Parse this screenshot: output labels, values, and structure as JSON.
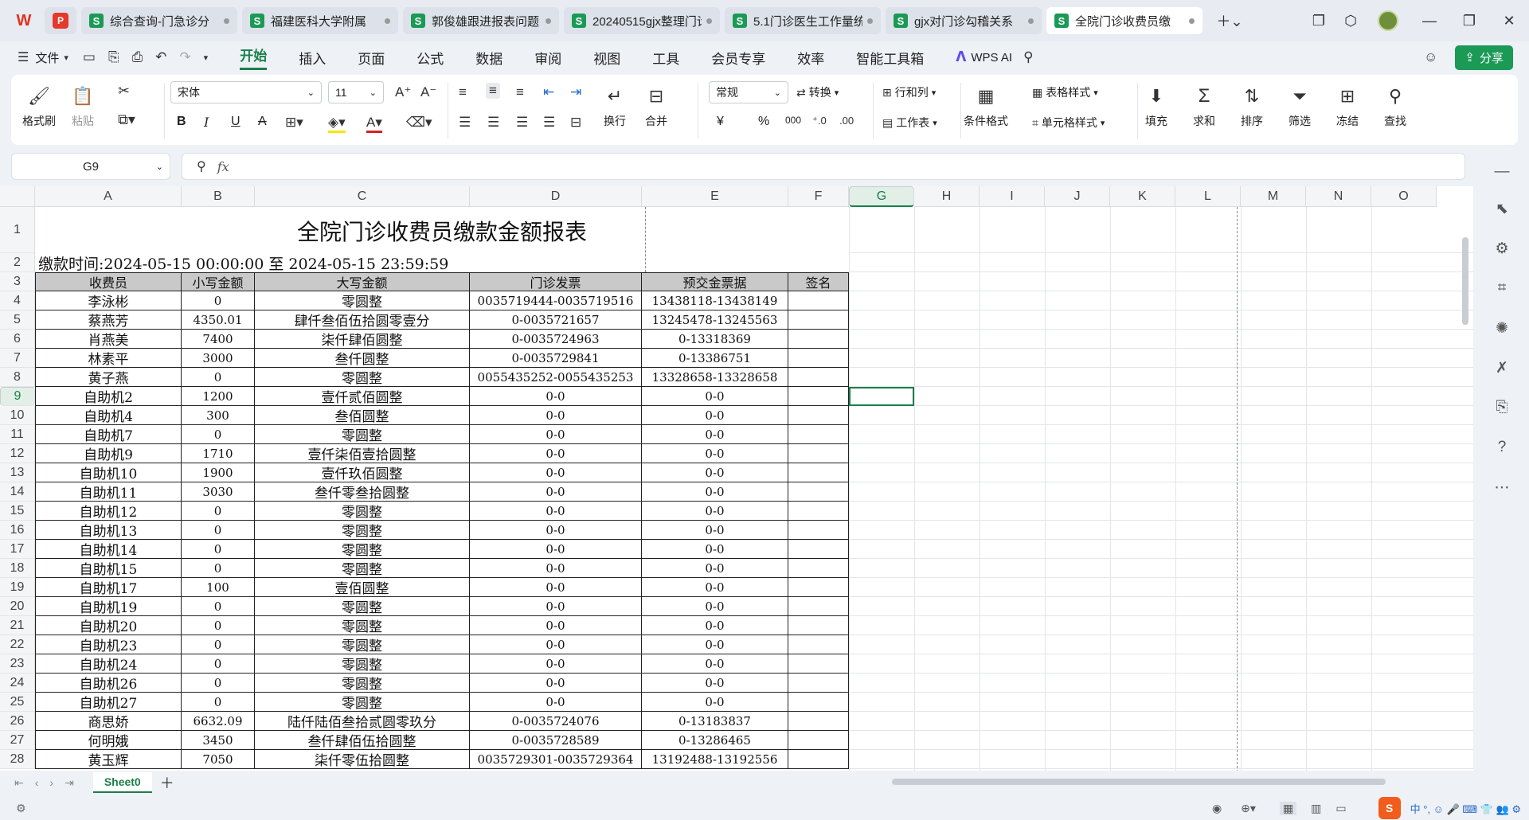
{
  "tabs": [
    {
      "label": "综合查询-门急诊分"
    },
    {
      "label": "福建医科大学附属"
    },
    {
      "label": "郭俊雄跟进报表问题"
    },
    {
      "label": "20240515gjx整理门诊"
    },
    {
      "label": "5.1门诊医生工作量统"
    },
    {
      "label": "gjx对门诊勾稽关系"
    },
    {
      "label": "全院门诊收费员缴"
    }
  ],
  "menu": {
    "file": "文件",
    "items": [
      "开始",
      "插入",
      "页面",
      "公式",
      "数据",
      "审阅",
      "视图",
      "工具",
      "会员专享",
      "效率",
      "智能工具箱"
    ],
    "wps_ai": "WPS AI",
    "share": "分享"
  },
  "ribbon": {
    "format_painter": "格式刷",
    "paste": "粘贴",
    "font_name": "宋体",
    "font_size": "11",
    "bold": "B",
    "italic": "I",
    "underline": "U",
    "strike": "A",
    "wrap": "换行",
    "merge": "合并",
    "number_format": "常规",
    "convert": "转换",
    "rows_cols": "行和列",
    "worksheet": "工作表",
    "conditional": "条件格式",
    "table_style": "表格样式",
    "cell_style": "单元格样式",
    "fill": "填充",
    "sum": "求和",
    "sort": "排序",
    "filter": "筛选",
    "freeze": "冻结",
    "find": "查找",
    "currency": "¥",
    "percent": "%",
    "thousands": "000"
  },
  "formula": {
    "cell_ref": "G9",
    "fx": "fx",
    "value": ""
  },
  "columns": [
    "A",
    "B",
    "C",
    "D",
    "E",
    "F",
    "G",
    "H",
    "I",
    "J",
    "K",
    "L",
    "M",
    "N",
    "O"
  ],
  "rows": [
    "1",
    "2",
    "3",
    "4",
    "5",
    "6",
    "7",
    "8",
    "9",
    "10",
    "11",
    "12",
    "13",
    "14",
    "15",
    "16",
    "17",
    "18",
    "19",
    "20",
    "21",
    "22",
    "23",
    "24",
    "25",
    "26",
    "27",
    "28"
  ],
  "report": {
    "title": "全院门诊收费员缴款金额报表",
    "period": "缴款时间:2024-05-15 00:00:00 至 2024-05-15 23:59:59",
    "headers": [
      "收费员",
      "小写金额",
      "大写金额",
      "门诊发票",
      "预交金票据",
      "签名"
    ],
    "data": [
      [
        "李泳彬",
        "0",
        "零圆整",
        "0035719444-0035719516",
        "13438118-13438149",
        ""
      ],
      [
        "蔡燕芳",
        "4350.01",
        "肆仟叁佰伍拾圆零壹分",
        "0-0035721657",
        "13245478-13245563",
        ""
      ],
      [
        "肖燕美",
        "7400",
        "柒仟肆佰圆整",
        "0-0035724963",
        "0-13318369",
        ""
      ],
      [
        "林素平",
        "3000",
        "叁仟圆整",
        "0-0035729841",
        "0-13386751",
        ""
      ],
      [
        "黄子燕",
        "0",
        "零圆整",
        "0055435252-0055435253",
        "13328658-13328658",
        ""
      ],
      [
        "自助机2",
        "1200",
        "壹仟贰佰圆整",
        "0-0",
        "0-0",
        ""
      ],
      [
        "自助机4",
        "300",
        "叁佰圆整",
        "0-0",
        "0-0",
        ""
      ],
      [
        "自助机7",
        "0",
        "零圆整",
        "0-0",
        "0-0",
        ""
      ],
      [
        "自助机9",
        "1710",
        "壹仟柒佰壹拾圆整",
        "0-0",
        "0-0",
        ""
      ],
      [
        "自助机10",
        "1900",
        "壹仟玖佰圆整",
        "0-0",
        "0-0",
        ""
      ],
      [
        "自助机11",
        "3030",
        "叁仟零叁拾圆整",
        "0-0",
        "0-0",
        ""
      ],
      [
        "自助机12",
        "0",
        "零圆整",
        "0-0",
        "0-0",
        ""
      ],
      [
        "自助机13",
        "0",
        "零圆整",
        "0-0",
        "0-0",
        ""
      ],
      [
        "自助机14",
        "0",
        "零圆整",
        "0-0",
        "0-0",
        ""
      ],
      [
        "自助机15",
        "0",
        "零圆整",
        "0-0",
        "0-0",
        ""
      ],
      [
        "自助机17",
        "100",
        "壹佰圆整",
        "0-0",
        "0-0",
        ""
      ],
      [
        "自助机19",
        "0",
        "零圆整",
        "0-0",
        "0-0",
        ""
      ],
      [
        "自助机20",
        "0",
        "零圆整",
        "0-0",
        "0-0",
        ""
      ],
      [
        "自助机23",
        "0",
        "零圆整",
        "0-0",
        "0-0",
        ""
      ],
      [
        "自助机24",
        "0",
        "零圆整",
        "0-0",
        "0-0",
        ""
      ],
      [
        "自助机26",
        "0",
        "零圆整",
        "0-0",
        "0-0",
        ""
      ],
      [
        "自助机27",
        "0",
        "零圆整",
        "0-0",
        "0-0",
        ""
      ],
      [
        "商思娇",
        "6632.09",
        "陆仟陆佰叁拾贰圆零玖分",
        "0-0035724076",
        "0-13183837",
        ""
      ],
      [
        "何明娥",
        "3450",
        "叁仟肆佰伍拾圆整",
        "0-0035728589",
        "0-13286465",
        ""
      ],
      [
        "黄玉辉",
        "7050",
        "柒仟零伍拾圆整",
        "0035729301-0035729364",
        "13192488-13192556",
        ""
      ]
    ]
  },
  "sheet_tab": "Sheet0",
  "colors": {
    "accent": "#1a7f4b",
    "header_fill": "#c9c9c9"
  }
}
